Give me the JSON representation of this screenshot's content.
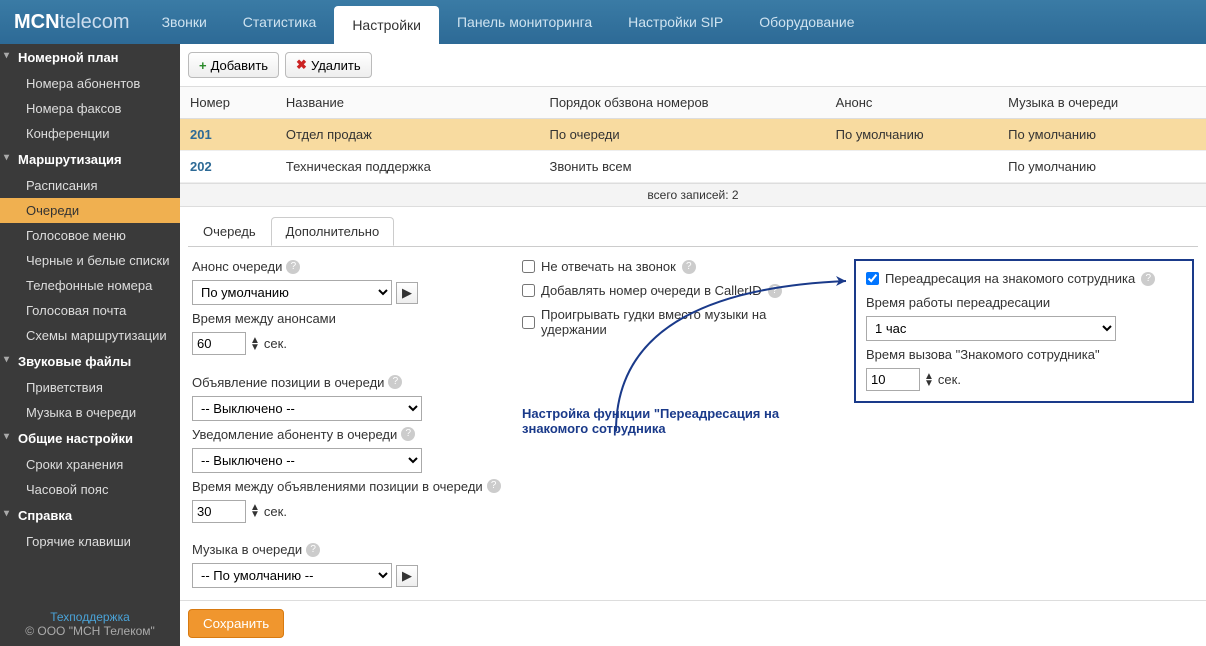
{
  "logo": {
    "bold": "MCN",
    "thin": "telecom"
  },
  "nav": [
    "Звонки",
    "Статистика",
    "Настройки",
    "Панель мониторинга",
    "Настройки SIP",
    "Оборудование"
  ],
  "nav_active": 2,
  "sidebar": {
    "groups": [
      {
        "title": "Номерной план",
        "items": [
          "Номера абонентов",
          "Номера факсов",
          "Конференции"
        ]
      },
      {
        "title": "Маршрутизация",
        "items": [
          "Расписания",
          "Очереди",
          "Голосовое меню",
          "Черные и белые списки",
          "Телефонные номера",
          "Голосовая почта",
          "Схемы маршрутизации"
        ],
        "active": 1
      },
      {
        "title": "Звуковые файлы",
        "items": [
          "Приветствия",
          "Музыка в очереди"
        ]
      },
      {
        "title": "Общие настройки",
        "items": [
          "Сроки хранения",
          "Часовой пояс"
        ]
      },
      {
        "title": "Справка",
        "items": [
          "Горячие клавиши"
        ]
      }
    ],
    "support": "Техподдержка",
    "copyright": "© ООО \"МСН Телеком\""
  },
  "toolbar": {
    "add": "Добавить",
    "del": "Удалить"
  },
  "table": {
    "headers": [
      "Номер",
      "Название",
      "Порядок обзвона номеров",
      "Анонс",
      "Музыка в очереди"
    ],
    "rows": [
      {
        "num": "201",
        "name": "Отдел продаж",
        "order": "По очереди",
        "announce": "По умолчанию",
        "music": "По умолчанию",
        "sel": true
      },
      {
        "num": "202",
        "name": "Техническая поддержка",
        "order": "Звонить всем",
        "announce": "",
        "music": "По умолчанию",
        "sel": false
      }
    ],
    "total": "всего записей: 2"
  },
  "tabs": [
    "Очередь",
    "Дополнительно"
  ],
  "tabs_active": 1,
  "form": {
    "announce_label": "Анонс очереди",
    "announce_value": "По умолчанию",
    "interval_label": "Время между анонсами",
    "interval_value": "60",
    "sec": "сек.",
    "position_label": "Объявление позиции в очереди",
    "position_value": "-- Выключено --",
    "notify_label": "Уведомление абоненту в очереди",
    "notify_value": "-- Выключено --",
    "pos_interval_label": "Время между объявлениями позиции в очереди",
    "pos_interval_value": "30",
    "music_label": "Музыка в очереди",
    "music_value": "-- По умолчанию --",
    "chk1": "Не отвечать на звонок",
    "chk2": "Добавлять номер очереди в CallerID",
    "chk3": "Проигрывать гудки вместо музыки на удержании",
    "redir_label": "Переадресация на знакомого сотрудника",
    "redir_time_label": "Время работы переадресации",
    "redir_time_value": "1 час",
    "redir_call_label": "Время вызова \"Знакомого сотрудника\"",
    "redir_call_value": "10",
    "annotation": "Настройка функции \"Переадресация на знакомого сотрудника"
  },
  "save": "Сохранить"
}
